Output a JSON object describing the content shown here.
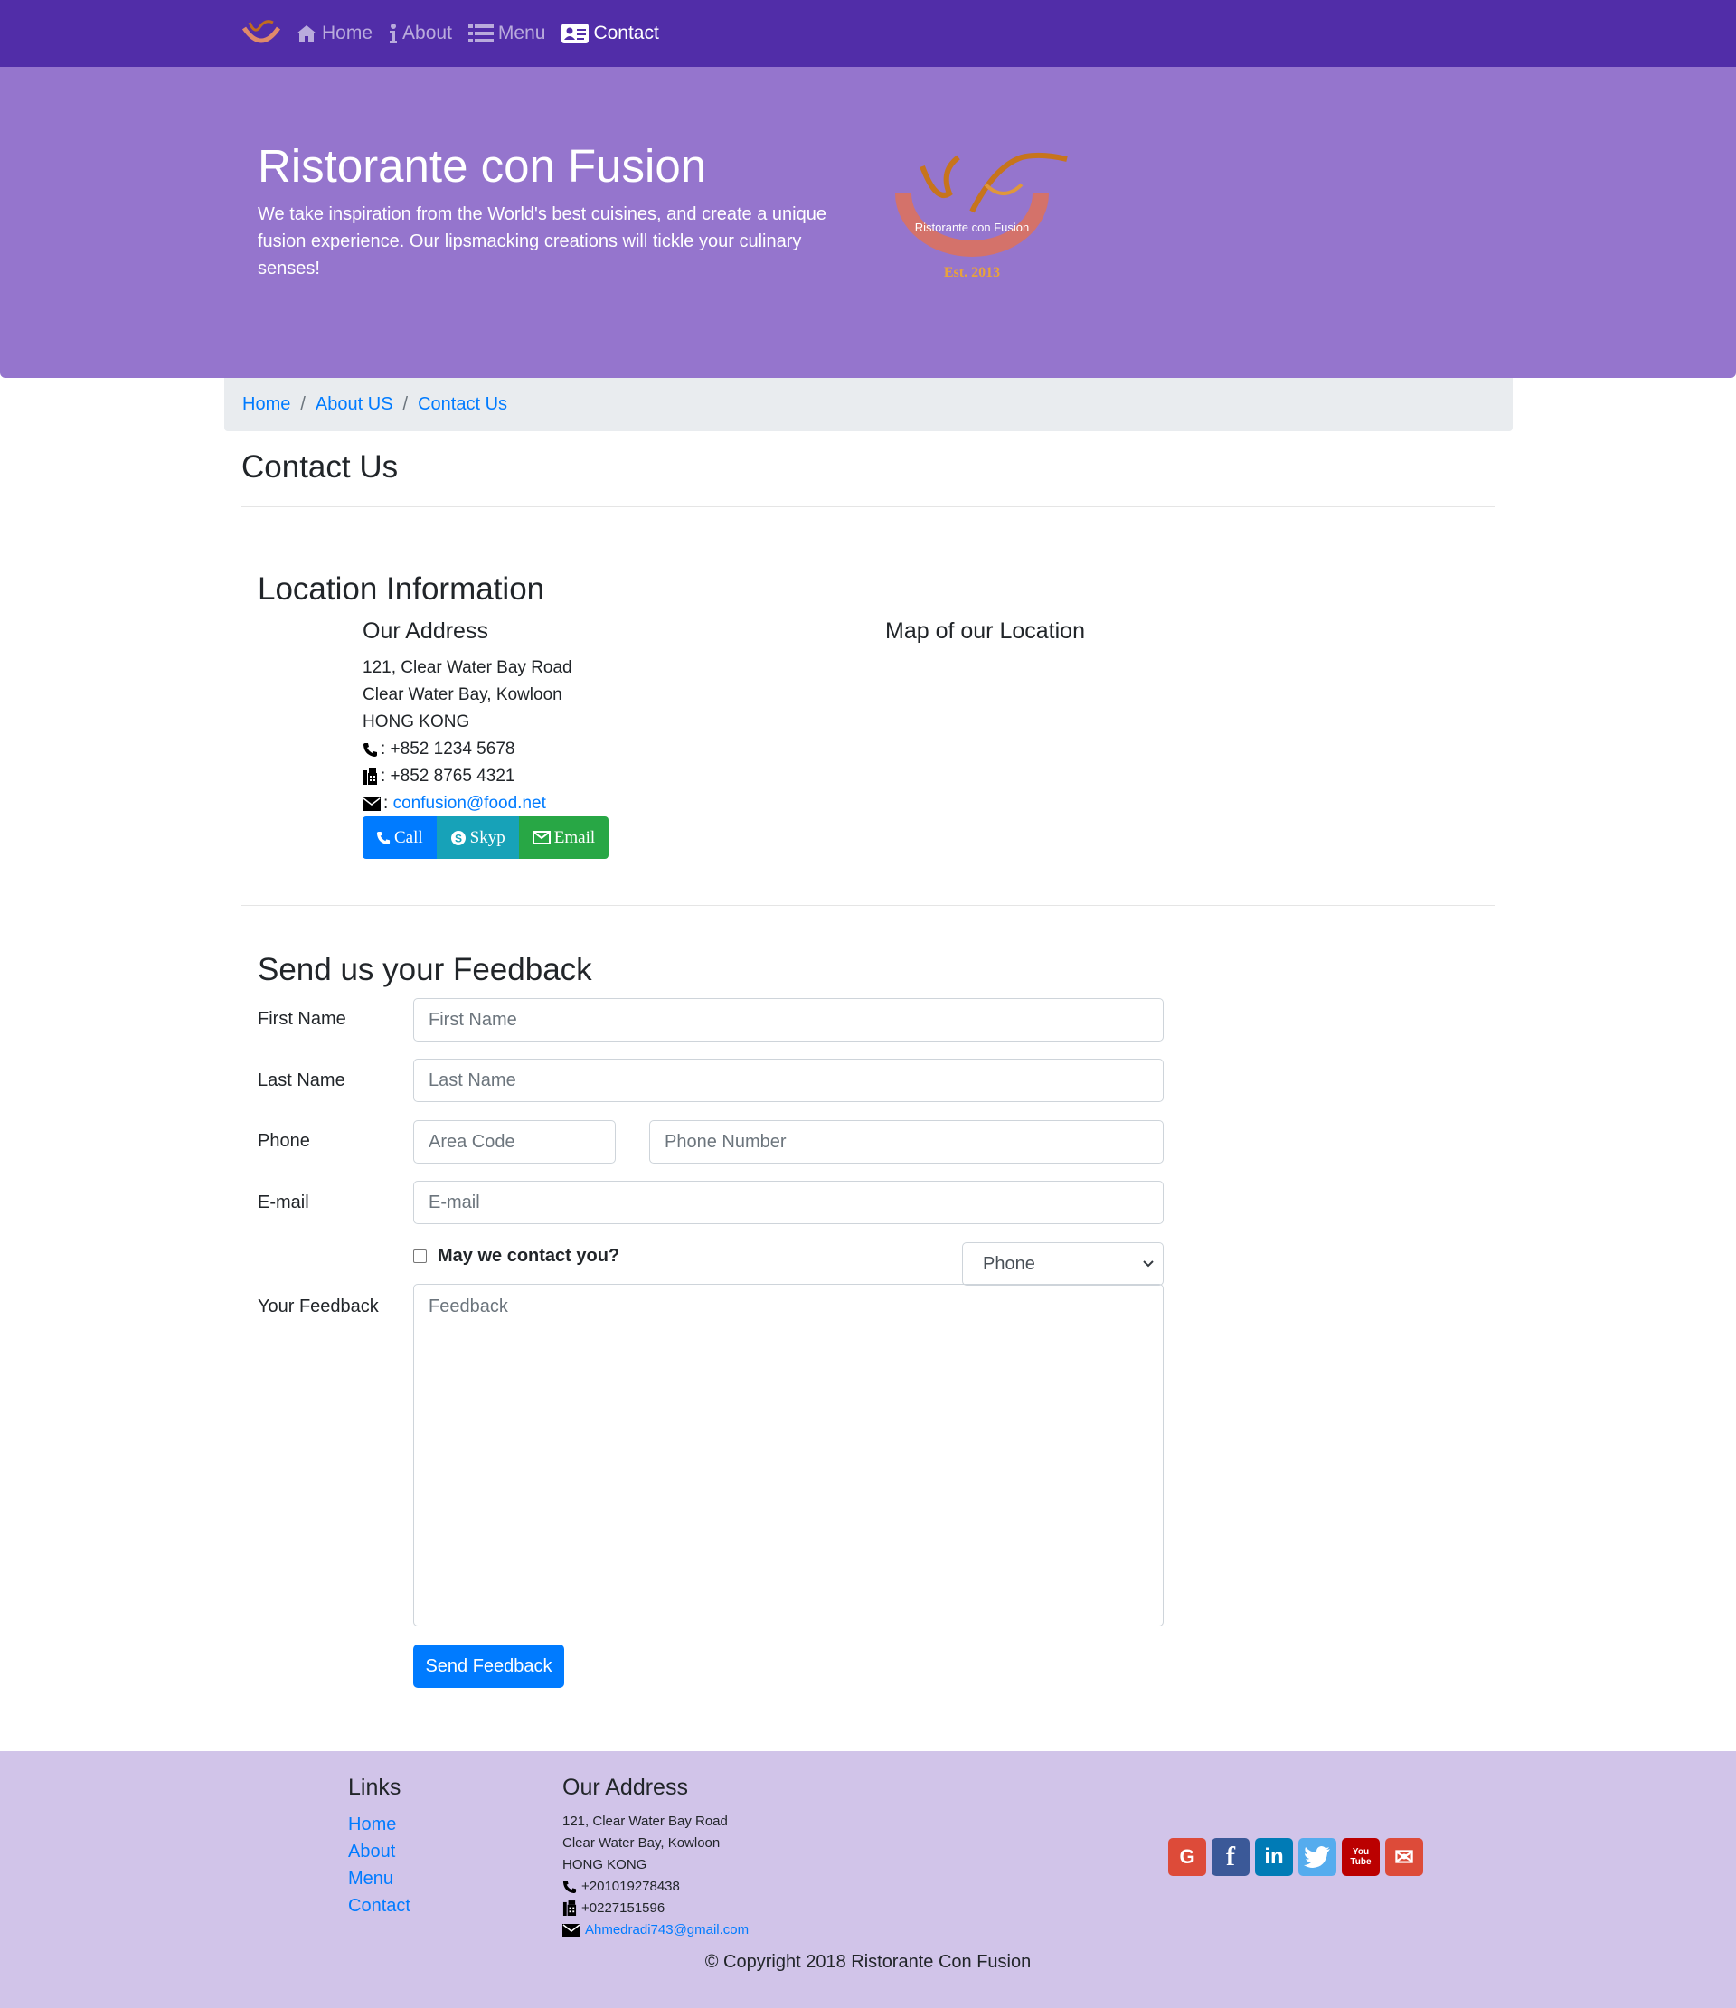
{
  "nav": {
    "items": [
      {
        "label": "Home",
        "icon": "home-icon"
      },
      {
        "label": "About",
        "icon": "info-icon"
      },
      {
        "label": "Menu",
        "icon": "list-icon"
      },
      {
        "label": "Contact",
        "icon": "address-card-icon"
      }
    ],
    "active": "Contact"
  },
  "jumbotron": {
    "title": "Ristorante con Fusion",
    "text": "We take inspiration from the World's best cuisines, and create a unique fusion experience. Our lipsmacking creations will tickle your culinary senses!",
    "logo_text": "Ristorante con Fusion",
    "logo_est": "Est. 2013"
  },
  "breadcrumb": [
    "Home",
    "About US",
    "Contact Us"
  ],
  "page_title": "Contact Us",
  "location": {
    "heading": "Location Information",
    "address_heading": "Our Address",
    "address_lines": [
      "121, Clear Water Bay Road",
      "Clear Water Bay, Kowloon",
      "HONG KONG"
    ],
    "phone": ": +852 1234 5678",
    "fax": ": +852 8765 4321",
    "email_prefix": ":",
    "email": "confusion@food.net",
    "map_heading": "Map of our Location",
    "buttons": {
      "call": "Call",
      "skype": "Skyp",
      "email": "Email"
    }
  },
  "feedback": {
    "heading": "Send us your Feedback",
    "first_name_label": "First Name",
    "first_name_placeholder": "First Name",
    "last_name_label": "Last Name",
    "last_name_placeholder": "Last Name",
    "phone_label": "Phone",
    "area_code_placeholder": "Area Code",
    "phone_number_placeholder": "Phone Number",
    "email_label": "E-mail",
    "email_placeholder": "E-mail",
    "contact_checkbox_label": "May we contact you?",
    "contact_select_value": "Phone",
    "feedback_label": "Your Feedback",
    "feedback_placeholder": "Feedback",
    "submit": "Send Feedback"
  },
  "footer": {
    "links_heading": "Links",
    "links": [
      "Home",
      "About",
      "Menu",
      "Contact"
    ],
    "address_heading": "Our Address",
    "address_lines": [
      "121, Clear Water Bay Road",
      "Clear Water Bay, Kowloon",
      "HONG KONG"
    ],
    "phone": "+201019278438",
    "fax": "+0227151596",
    "email": "Ahmedradi743@gmail.com",
    "social": [
      {
        "name": "google-icon",
        "glyph": "G",
        "color": "#dd4b39"
      },
      {
        "name": "facebook-icon",
        "glyph": "f",
        "color": "#3b5998"
      },
      {
        "name": "linkedin-icon",
        "glyph": "in",
        "color": "#007bb6"
      },
      {
        "name": "twitter-icon",
        "glyph": "t",
        "color": "#55acee"
      },
      {
        "name": "youtube-icon",
        "glyph": "You Tube",
        "color": "#bb0000"
      },
      {
        "name": "mail-icon",
        "glyph": "✉",
        "color": "#dd4b39"
      }
    ],
    "copyright": "© Copyright 2018 Ristorante Con Fusion"
  },
  "colors": {
    "navbar": "#512da8",
    "jumbotron": "#9575cd",
    "footer": "#d1c4e9",
    "primary": "#007bff",
    "info": "#17a2b8",
    "success": "#28a745"
  }
}
